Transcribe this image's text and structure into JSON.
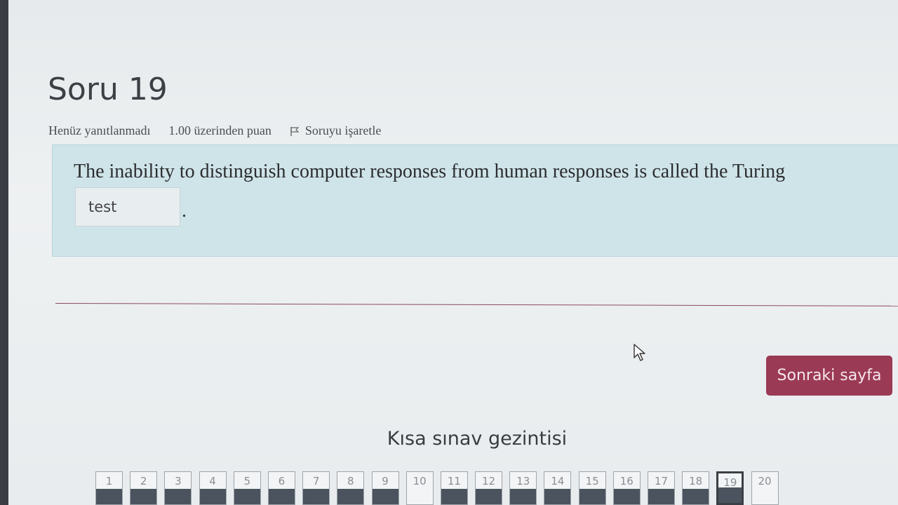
{
  "question": {
    "title": "Soru 19",
    "status": "Henüz yanıtlanmadı",
    "marks": "1.00 üzerinden puan",
    "flag_label": "Soruyu işaretle",
    "text": "The inability to distinguish computer responses from human responses is called the Turing",
    "answer_value": "test",
    "text_after": "."
  },
  "actions": {
    "next_label": "Sonraki sayfa"
  },
  "navigation": {
    "title": "Kısa sınav gezintisi",
    "buttons": [
      "1",
      "2",
      "3",
      "4",
      "5",
      "6",
      "7",
      "8",
      "9",
      "10",
      "11",
      "12",
      "13",
      "14",
      "15",
      "16",
      "17",
      "18",
      "19",
      "20"
    ],
    "current": "19"
  },
  "colors": {
    "accent": "#9b3a55",
    "question_bg": "#cfe4e8"
  }
}
